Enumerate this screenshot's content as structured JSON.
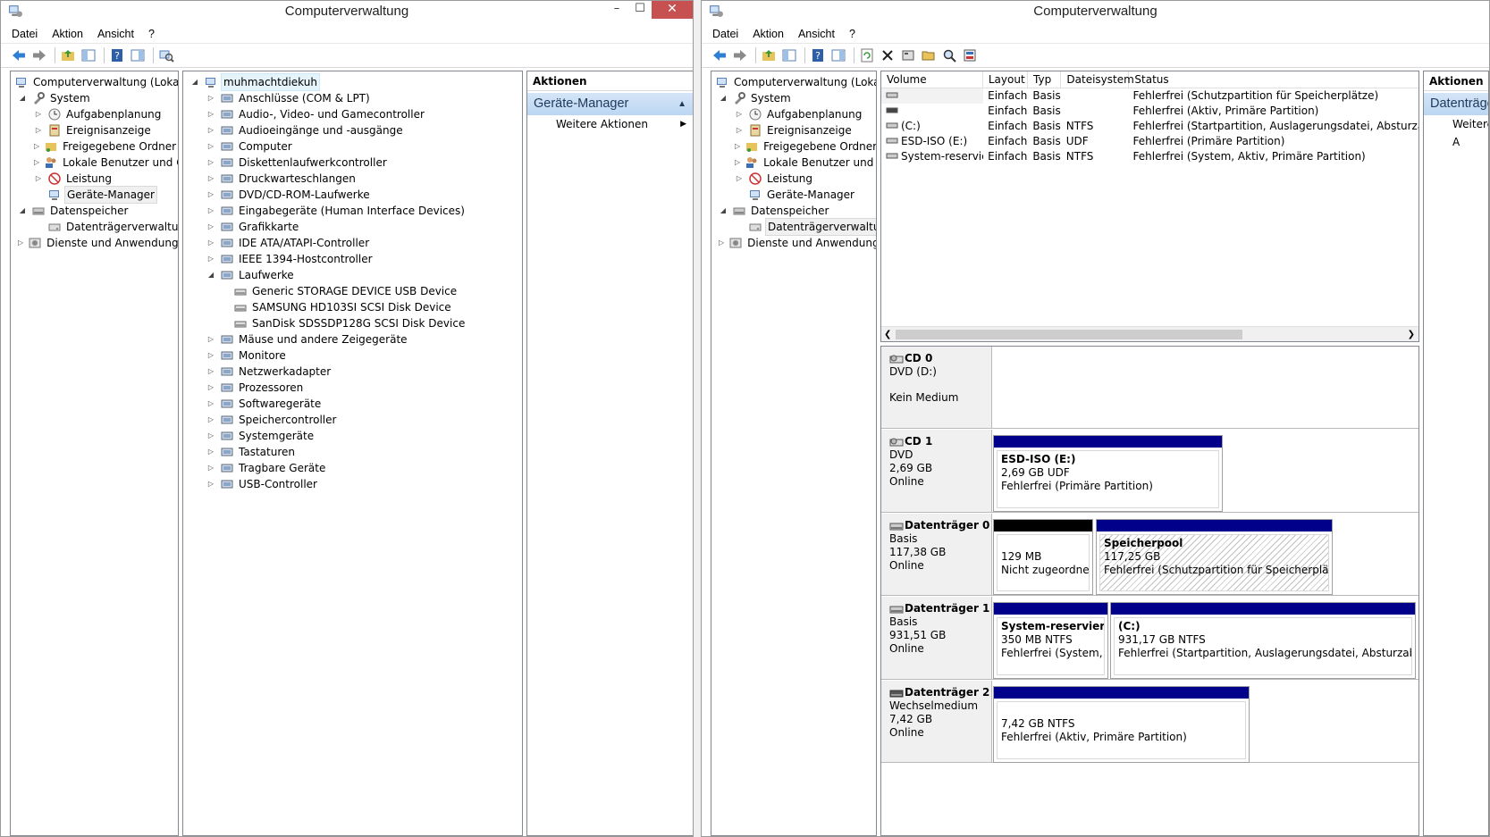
{
  "left_window": {
    "title": "Computerverwaltung",
    "controls": {
      "minimize": "–",
      "maximize": "☐",
      "close": "✕"
    },
    "menu": [
      "Datei",
      "Aktion",
      "Ansicht",
      "?"
    ],
    "tree": {
      "root": "Computerverwaltung (Lokal)",
      "system": "System",
      "aufgaben": "Aufgabenplanung",
      "ereignis": "Ereignisanzeige",
      "freigabe": "Freigegebene Ordner",
      "benutzer": "Lokale Benutzer und Gr",
      "leistung": "Leistung",
      "geraete": "Geräte-Manager",
      "datenspeicher": "Datenspeicher",
      "datentraeger": "Datenträgerverwaltung",
      "dienste": "Dienste und Anwendungen"
    },
    "devices": {
      "computer_name": "muhmachtdiekuh",
      "items": [
        "Anschlüsse (COM & LPT)",
        "Audio-, Video- und Gamecontroller",
        "Audioeingänge und -ausgänge",
        "Computer",
        "Diskettenlaufwerkcontroller",
        "Druckwarteschlangen",
        "DVD/CD-ROM-Laufwerke",
        "Eingabegeräte (Human Interface Devices)",
        "Grafikkarte",
        "IDE ATA/ATAPI-Controller",
        "IEEE 1394-Hostcontroller",
        "Laufwerke"
      ],
      "drives": [
        "Generic STORAGE DEVICE USB Device",
        "SAMSUNG HD103SI SCSI Disk Device",
        "SanDisk SDSSDP128G SCSI Disk Device"
      ],
      "items_after": [
        "Mäuse und andere Zeigegeräte",
        "Monitore",
        "Netzwerkadapter",
        "Prozessoren",
        "Softwaregeräte",
        "Speichercontroller",
        "Systemgeräte",
        "Tastaturen",
        "Tragbare Geräte",
        "USB-Controller"
      ]
    },
    "actions": {
      "header": "Aktionen",
      "section": "Geräte-Manager",
      "more": "Weitere Aktionen"
    }
  },
  "right_window": {
    "title": "Computerverwaltung",
    "menu": [
      "Datei",
      "Aktion",
      "Ansicht",
      "?"
    ],
    "tree": {
      "root": "Computerverwaltung (Lokal)",
      "system": "System",
      "aufgaben": "Aufgabenplanung",
      "ereignis": "Ereignisanzeige",
      "freigabe": "Freigegebene Ordner",
      "benutzer": "Lokale Benutzer und Gr",
      "leistung": "Leistung",
      "geraete": "Geräte-Manager",
      "datenspeicher": "Datenspeicher",
      "datentraeger": "Datenträgerverwaltung",
      "dienste": "Dienste und Anwendungen"
    },
    "volume_columns": [
      "Volume",
      "Layout",
      "Typ",
      "Dateisystem",
      "Status"
    ],
    "volumes": [
      {
        "name": "",
        "layout": "Einfach",
        "type": "Basis",
        "fs": "",
        "status": "Fehlerfrei (Schutzpartition für Speicherplätze)"
      },
      {
        "name": "",
        "layout": "Einfach",
        "type": "Basis",
        "fs": "",
        "status": "Fehlerfrei (Aktiv, Primäre Partition)"
      },
      {
        "name": "(C:)",
        "layout": "Einfach",
        "type": "Basis",
        "fs": "NTFS",
        "status": "Fehlerfrei (Startpartition, Auslagerungsdatei, Absturzabbild"
      },
      {
        "name": "ESD-ISO (E:)",
        "layout": "Einfach",
        "type": "Basis",
        "fs": "UDF",
        "status": "Fehlerfrei (Primäre Partition)"
      },
      {
        "name": "System-reserviert",
        "layout": "Einfach",
        "type": "Basis",
        "fs": "NTFS",
        "status": "Fehlerfrei (System, Aktiv, Primäre Partition)"
      }
    ],
    "disks": {
      "cd0": {
        "name": "CD 0",
        "l1": "DVD (D:)",
        "l2": "",
        "l3": "Kein Medium"
      },
      "cd1": {
        "name": "CD 1",
        "l1": "DVD",
        "l2": "2,69 GB",
        "l3": "Online",
        "p1": {
          "title": "ESD-ISO  (E:)",
          "size": "2,69 GB UDF",
          "status": "Fehlerfrei (Primäre Partition)"
        }
      },
      "d0": {
        "name": "Datenträger 0",
        "l1": "Basis",
        "l2": "117,38 GB",
        "l3": "Online",
        "p1": {
          "size": "129 MB",
          "status": "Nicht zugeordnet"
        },
        "p2": {
          "title": "Speicherpool",
          "size": "117,25 GB",
          "status": "Fehlerfrei (Schutzpartition für Speicherplätze)"
        }
      },
      "d1": {
        "name": "Datenträger 1",
        "l1": "Basis",
        "l2": "931,51 GB",
        "l3": "Online",
        "p1": {
          "title": "System-reserviert",
          "size": "350 MB NTFS",
          "status": "Fehlerfrei (System, Aktiv"
        },
        "p2": {
          "title": "(C:)",
          "size": "931,17 GB NTFS",
          "status": "Fehlerfrei (Startpartition, Auslagerungsdatei, Absturzabbild,"
        }
      },
      "d2": {
        "name": "Datenträger 2",
        "l1": "Wechselmedium",
        "l2": "7,42 GB",
        "l3": "Online",
        "p1": {
          "size": "7,42 GB NTFS",
          "status": "Fehlerfrei (Aktiv, Primäre Partition)"
        }
      }
    },
    "actions": {
      "header": "Aktionen",
      "section": "Datenträge",
      "more": "Weitere A"
    }
  }
}
